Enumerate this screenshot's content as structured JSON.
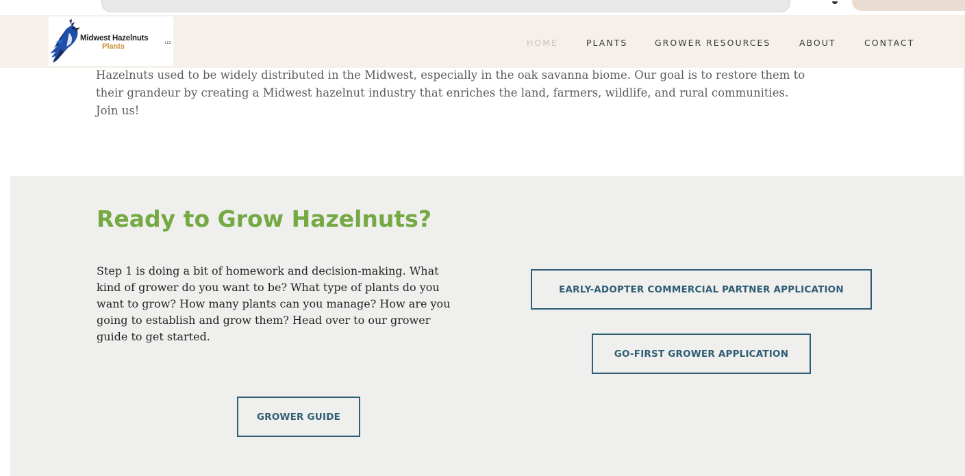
{
  "brand": {
    "name": "Midwest Hazelnuts",
    "sub": "Plants",
    "llc": "LLC",
    "colors": {
      "bird": "#1f4fa8",
      "name": "#1d1d1d",
      "sub": "#c98a2e"
    }
  },
  "nav": {
    "items": [
      {
        "label": "HOME",
        "active": true
      },
      {
        "label": "PLANTS",
        "active": false
      },
      {
        "label": "GROWER RESOURCES",
        "active": false
      },
      {
        "label": "ABOUT",
        "active": false
      },
      {
        "label": "CONTACT",
        "active": false
      }
    ]
  },
  "intro": {
    "lines": [
      "Hazelnuts used to be widely distributed in the Midwest, especially in the oak savanna biome. Our goal is to restore them to",
      "their grandeur by creating a Midwest hazelnut industry that enriches the land, farmers, wildlife, and rural communities.",
      "Join us!"
    ]
  },
  "grow": {
    "heading": "Ready to Grow Hazelnuts?",
    "lines": [
      "Step 1 is doing a bit of homework and decision-making.  What",
      "kind of grower do you want to be? What type of plants do you",
      "want to grow? How many plants can you manage? How are you",
      "going to establish and grow them? Head over to our grower",
      "guide to get started."
    ],
    "buttons": {
      "guide": "GROWER GUIDE",
      "commercial": "EARLY-ADOPTER COMMERCIAL PARTNER APPLICATION",
      "gofirst": "GO-FIRST GROWER APPLICATION"
    }
  },
  "colors": {
    "header_bg": "#f6f0eb",
    "section_bg": "#efefed",
    "heading": "#74a943",
    "button": "#2e5d74",
    "nav_active": "#c9c3bd"
  }
}
